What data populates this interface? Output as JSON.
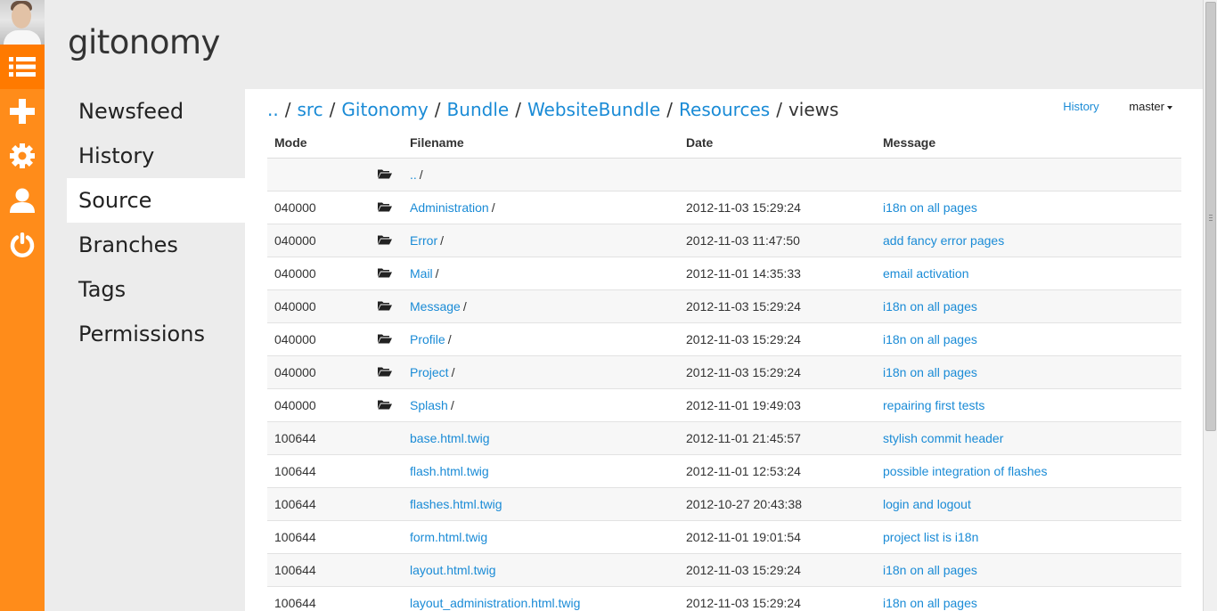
{
  "app": {
    "brand": "gitonomy"
  },
  "rail": {
    "items": [
      {
        "icon": "list-icon",
        "active": true
      },
      {
        "icon": "plus-icon",
        "active": false
      },
      {
        "icon": "gear-icon",
        "active": false
      },
      {
        "icon": "user-icon",
        "active": false
      },
      {
        "icon": "power-icon",
        "active": false
      }
    ],
    "accent": "#ff8c1a"
  },
  "subnav": {
    "items": [
      {
        "label": "Newsfeed",
        "active": false
      },
      {
        "label": "History",
        "active": false
      },
      {
        "label": "Source",
        "active": true
      },
      {
        "label": "Branches",
        "active": false
      },
      {
        "label": "Tags",
        "active": false
      },
      {
        "label": "Permissions",
        "active": false
      }
    ]
  },
  "breadcrumb": {
    "links": [
      "..",
      "src",
      "Gitonomy",
      "Bundle",
      "WebsiteBundle",
      "Resources"
    ],
    "separator": "/",
    "current": "views"
  },
  "actions": {
    "history_label": "History",
    "branch_label": "master"
  },
  "table": {
    "columns": [
      "Mode",
      "",
      "Filename",
      "Date",
      "Message"
    ],
    "rows": [
      {
        "mode": "",
        "folder": true,
        "name": "..",
        "date": "",
        "message": ""
      },
      {
        "mode": "040000",
        "folder": true,
        "name": "Administration",
        "date": "2012-11-03 15:29:24",
        "message": "i18n on all pages"
      },
      {
        "mode": "040000",
        "folder": true,
        "name": "Error",
        "date": "2012-11-03 11:47:50",
        "message": "add fancy error pages"
      },
      {
        "mode": "040000",
        "folder": true,
        "name": "Mail",
        "date": "2012-11-01 14:35:33",
        "message": "email activation"
      },
      {
        "mode": "040000",
        "folder": true,
        "name": "Message",
        "date": "2012-11-03 15:29:24",
        "message": "i18n on all pages"
      },
      {
        "mode": "040000",
        "folder": true,
        "name": "Profile",
        "date": "2012-11-03 15:29:24",
        "message": "i18n on all pages"
      },
      {
        "mode": "040000",
        "folder": true,
        "name": "Project",
        "date": "2012-11-03 15:29:24",
        "message": "i18n on all pages"
      },
      {
        "mode": "040000",
        "folder": true,
        "name": "Splash",
        "date": "2012-11-01 19:49:03",
        "message": "repairing first tests"
      },
      {
        "mode": "100644",
        "folder": false,
        "name": "base.html.twig",
        "date": "2012-11-01 21:45:57",
        "message": "stylish commit header"
      },
      {
        "mode": "100644",
        "folder": false,
        "name": "flash.html.twig",
        "date": "2012-11-01 12:53:24",
        "message": "possible integration of flashes"
      },
      {
        "mode": "100644",
        "folder": false,
        "name": "flashes.html.twig",
        "date": "2012-10-27 20:43:38",
        "message": "login and logout"
      },
      {
        "mode": "100644",
        "folder": false,
        "name": "form.html.twig",
        "date": "2012-11-01 19:01:54",
        "message": "project list is i18n"
      },
      {
        "mode": "100644",
        "folder": false,
        "name": "layout.html.twig",
        "date": "2012-11-03 15:29:24",
        "message": "i18n on all pages"
      },
      {
        "mode": "100644",
        "folder": false,
        "name": "layout_administration.html.twig",
        "date": "2012-11-03 15:29:24",
        "message": "i18n on all pages"
      }
    ]
  },
  "colors": {
    "link": "#1a8bd6",
    "rail": "#ff8c1a",
    "stripe": "#f7f7f7"
  }
}
